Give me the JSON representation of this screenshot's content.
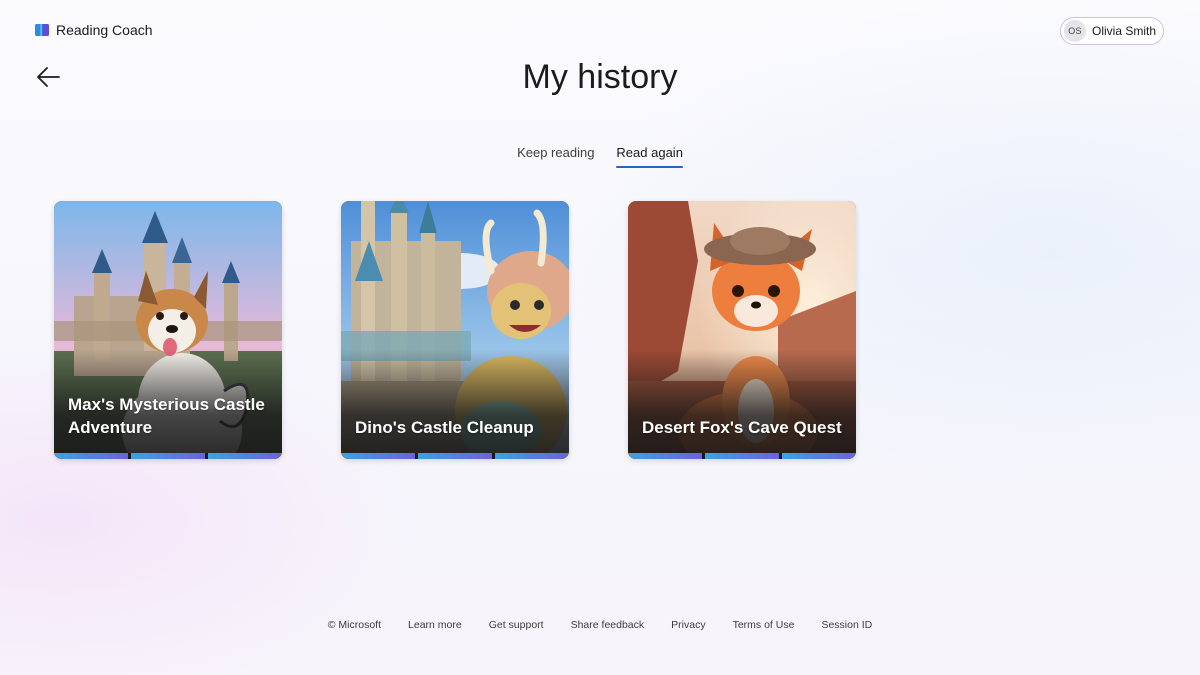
{
  "app": {
    "name": "Reading Coach",
    "logo_icon": "book-icon"
  },
  "user": {
    "initials": "OS",
    "name": "Olivia Smith"
  },
  "header": {
    "back_icon": "arrow-left-icon",
    "title": "My history"
  },
  "tabs": [
    {
      "label": "Keep reading",
      "active": false
    },
    {
      "label": "Read again",
      "active": true
    }
  ],
  "stories": [
    {
      "title": "Max's Mysterious Castle Adventure",
      "image": "cartoon dog in front of fairytale castle",
      "progress_segments": 3
    },
    {
      "title": "Dino's Castle Cleanup",
      "image": "cartoon triceratops beside castle towers",
      "progress_segments": 3
    },
    {
      "title": "Desert Fox's Cave Quest",
      "image": "cartoon fox with hat in desert canyon",
      "progress_segments": 3
    }
  ],
  "footer": {
    "copyright": "© Microsoft",
    "links": [
      "Learn more",
      "Get support",
      "Share feedback",
      "Privacy",
      "Terms of Use",
      "Session ID"
    ]
  },
  "colors": {
    "accent": "#2465c6",
    "progress_start": "#3ba3e0",
    "progress_end": "#6b63d9"
  }
}
